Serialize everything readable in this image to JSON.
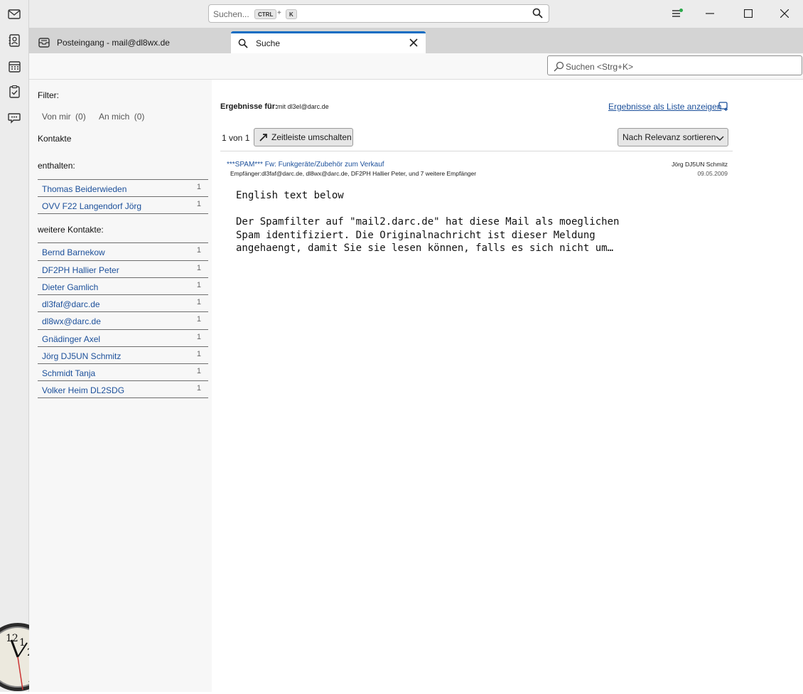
{
  "spaces": [
    {
      "icon": "mail-icon"
    },
    {
      "icon": "address-book-icon"
    },
    {
      "icon": "calendar-icon"
    },
    {
      "icon": "tasks-icon"
    },
    {
      "icon": "chat-icon"
    }
  ],
  "titlebar": {
    "search_placeholder": "Suchen...",
    "shortcut_key1": "CTRL",
    "shortcut_plus": "+",
    "shortcut_key2": "K"
  },
  "tabs": [
    {
      "label": "Posteingang - mail@dl8wx.de",
      "icon": "inbox-icon",
      "active": false
    },
    {
      "label": "Suche",
      "icon": "search-icon",
      "active": true
    }
  ],
  "quick_search": {
    "placeholder": "Suchen <Strg+K>"
  },
  "facets": {
    "filter_label": "Filter:",
    "from_me": "Von mir",
    "from_me_count": "(0)",
    "to_me": "An mich",
    "to_me_count": "(0)",
    "contacts_heading": "Kontakte",
    "contains_heading": "enthalten:",
    "contains": [
      {
        "name": "Thomas Beiderwieden",
        "count": "1"
      },
      {
        "name": "OVV F22 Langendorf Jörg",
        "count": "1"
      }
    ],
    "more_heading": "weitere Kontakte:",
    "more": [
      {
        "name": "Bernd Barnekow",
        "count": "1"
      },
      {
        "name": "DF2PH Hallier Peter",
        "count": "1"
      },
      {
        "name": "Dieter Gamlich",
        "count": "1"
      },
      {
        "name": "dl3faf@darc.de",
        "count": "1"
      },
      {
        "name": "dl8wx@darc.de",
        "count": "1"
      },
      {
        "name": "Gnädinger Axel",
        "count": "1"
      },
      {
        "name": "Jörg DJ5UN Schmitz",
        "count": "1"
      },
      {
        "name": "Schmidt Tanja",
        "count": "1"
      },
      {
        "name": "Volker Heim DL2SDG",
        "count": "1"
      }
    ]
  },
  "results": {
    "results_for_label": "Ergebnisse für:",
    "query": "mit dl3el@darc.de",
    "show_list_link": "Ergebnisse als Liste anzeigen",
    "page_info": "1 von 1",
    "timeline_toggle": "Zeitleiste umschalten",
    "sort_button": "Nach Relevanz sortieren",
    "items": [
      {
        "subject": "***SPAM*** Fw: Funkgeräte/Zubehör zum Verkauf",
        "recipients": "Empfänger:dl3faf@darc.de, dl8wx@darc.de, DF2PH Hallier Peter, und 7 weitere Empfänger",
        "sender": "Jörg DJ5UN Schmitz",
        "date": "09.05.2009",
        "snippet": "English text below\n\nDer Spamfilter auf \"mail2.darc.de\" hat diese Mail als moeglichen\nSpam identifiziert. Die Originalnachricht ist dieser Meldung\nangehaengt, damit Sie sie lesen können, falls es sich nicht um…"
      }
    ]
  },
  "colors": {
    "accent": "#0b6cc3",
    "link": "#1b4f9a",
    "status_dot": "#2aa84a"
  }
}
